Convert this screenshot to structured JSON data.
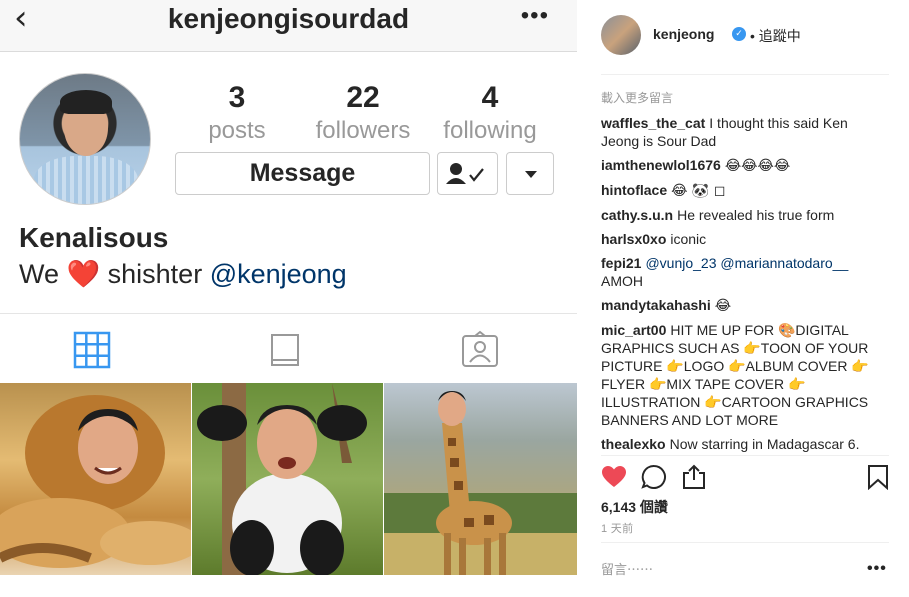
{
  "left_panel": {
    "handle": "kenjeongisourdad",
    "back_glyph": "‹",
    "more_glyph": "•••",
    "stats": [
      {
        "num": "3",
        "label": "posts"
      },
      {
        "num": "22",
        "label": "followers"
      },
      {
        "num": "4",
        "label": "following"
      }
    ],
    "message_label": "Message",
    "display_name": "Kenalisous",
    "bio": {
      "prefix": "We ",
      "heart": "❤️",
      "middle": " shishter ",
      "mention": "@kenjeong"
    },
    "tabs": [
      "grid-icon",
      "feed-icon",
      "tagged-icon"
    ],
    "posts": [
      "lion",
      "panda",
      "giraffe"
    ]
  },
  "right_panel": {
    "username": "kenjeong",
    "follow_state": "• 追蹤中",
    "load_more": "載入更多留言",
    "comments": [
      {
        "user": "waffles_the_cat",
        "text": "I thought this said Ken Jeong is Sour Dad"
      },
      {
        "user": "iamthenewlol1676",
        "text": "😂😂😂😂"
      },
      {
        "user": "hintoflace",
        "text": "😂 🐼 ◻"
      },
      {
        "user": "cathy.s.u.n",
        "text": "He revealed his true form"
      },
      {
        "user": "harlsx0xo",
        "text": "iconic"
      },
      {
        "user": "fepi21",
        "mentions": "@vunjo_23 @mariannatodaro__",
        "text": "AMOH"
      },
      {
        "user": "mandytakahashi",
        "text": "😂"
      },
      {
        "user": "mic_art00",
        "text": "HIT ME UP FOR 🎨DIGITAL GRAPHICS SUCH AS 👉TOON OF YOUR PICTURE 👉LOGO 👉ALBUM COVER 👉 FLYER 👉MIX TAPE COVER 👉 ILLUSTRATION 👉CARTOON GRAPHICS BANNERS AND LOT MORE"
      },
      {
        "user": "thealexko",
        "text": "Now starring in Madagascar 6."
      }
    ],
    "views": "6,143 個讚",
    "timestamp": "1 天前",
    "comment_placeholder": "留言⋯⋯",
    "options_glyph": "•••",
    "colors": {
      "accent": "#3897f0",
      "like": "#ed4956",
      "mention": "#003569"
    }
  }
}
